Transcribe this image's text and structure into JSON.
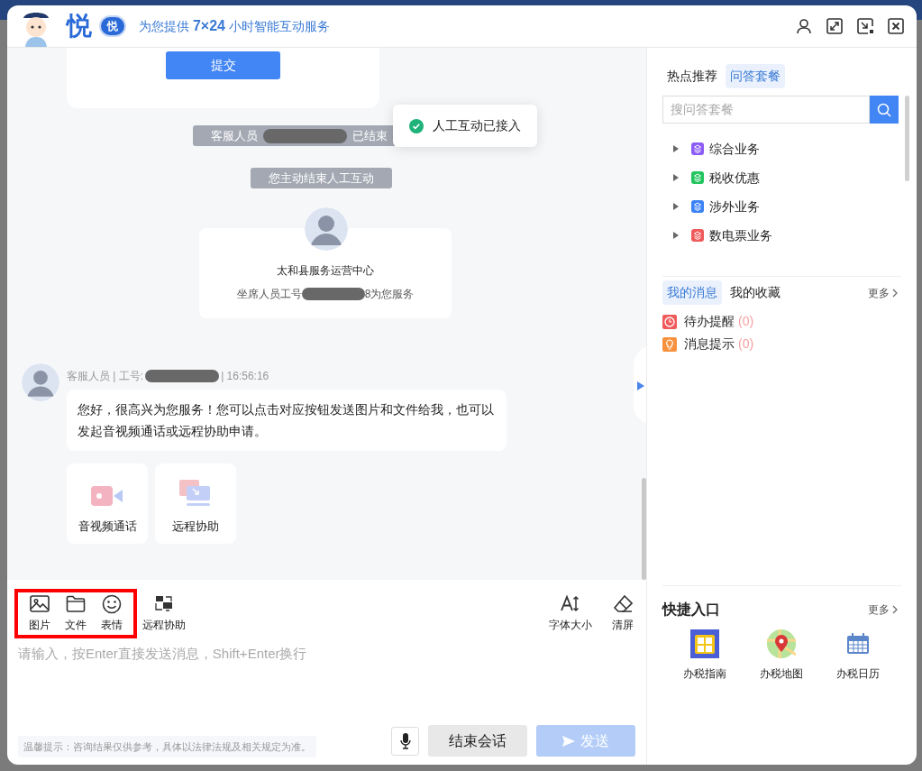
{
  "header": {
    "brand": "悦",
    "badge": "悦",
    "slogan": "为您提供 **7×24** 小时智能互动服务"
  },
  "chat": {
    "form_card": {
      "button": "提交"
    },
    "system_notes": [
      {
        "kind": "redacted",
        "before": "客服人员",
        "after": "已结束"
      },
      {
        "kind": "plain",
        "text": "您主动结束人工互动"
      }
    ],
    "agent_card": {
      "org": "太和县服务运营中心",
      "before": "坐席人员工号",
      "after": "8为您服务"
    },
    "message": {
      "sender": "客服人员 | 工号:",
      "time": "| 16:56:16",
      "text": "您好，很高兴为您服务！您可以点击对应按钮发送图片和文件给我，也可以发起音视频通话或远程协助申请。"
    },
    "actions": [
      {
        "kind": "video",
        "label": "音视频通话"
      },
      {
        "kind": "remote",
        "label": "远程协助"
      }
    ]
  },
  "toast": {
    "text": "人工互动已接入"
  },
  "composer": {
    "tools": [
      {
        "kind": "image",
        "label": "图片",
        "highlighted": true
      },
      {
        "kind": "folder",
        "label": "文件",
        "highlighted": true
      },
      {
        "kind": "emoji",
        "label": "表情",
        "highlighted": true
      },
      {
        "kind": "remote",
        "label": "远程协助",
        "highlighted": false
      }
    ],
    "right_tools": [
      {
        "kind": "font",
        "label": "字体大小"
      },
      {
        "kind": "eraser",
        "label": "清屏"
      }
    ],
    "placeholder": "请输入，按Enter直接发送消息，Shift+Enter换行",
    "tip": "温馨提示：咨询结果仅供参考，具体以法律法规及相关规定为准。",
    "end_button": "结束会话",
    "send_button": {
      "label": "发送",
      "disabled": true
    }
  },
  "sidebar": {
    "tabs": [
      {
        "label": "热点推荐",
        "selected": false
      },
      {
        "label": "问答套餐",
        "selected": true
      }
    ],
    "search": {
      "placeholder": "搜问答套餐"
    },
    "tree": [
      {
        "label": "综合业务",
        "color": "#8b5cf6",
        "expanded": false
      },
      {
        "label": "税收优惠",
        "color": "#22c55e",
        "expanded": false
      },
      {
        "label": "涉外业务",
        "color": "#3b82f6",
        "expanded": false
      },
      {
        "label": "数电票业务",
        "color": "#f05a5a",
        "expanded": false
      }
    ],
    "message_tabs": [
      {
        "label": "我的消息",
        "selected": true
      },
      {
        "label": "我的收藏",
        "selected": false
      }
    ],
    "messages_more": "更多",
    "messages": [
      {
        "kind": "todo",
        "label": "待办提醒",
        "count": "(0)"
      },
      {
        "kind": "notice",
        "label": "消息提示",
        "count": "(0)"
      }
    ],
    "shortcuts": {
      "title": "快捷入口",
      "more": "更多",
      "items": [
        {
          "kind": "guide",
          "label": "办税指南"
        },
        {
          "kind": "map",
          "label": "办税地图"
        },
        {
          "kind": "calendar",
          "label": "办税日历"
        }
      ]
    }
  }
}
